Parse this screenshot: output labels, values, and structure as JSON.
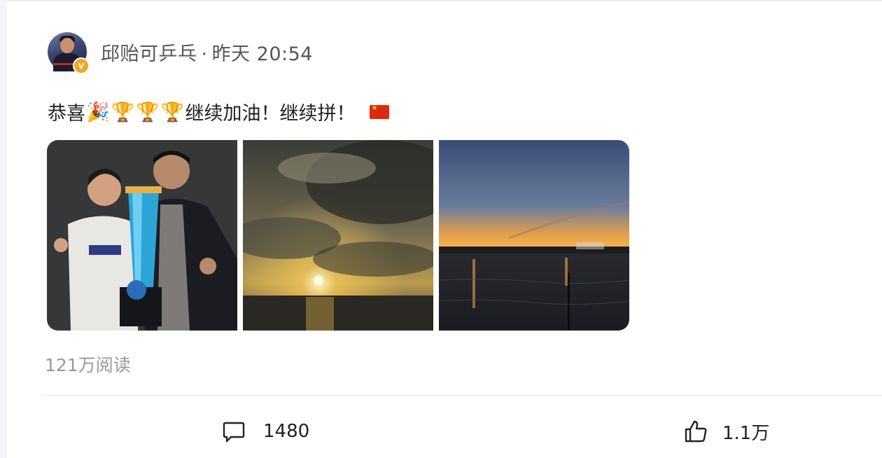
{
  "post": {
    "author": "邱贻可乒乓",
    "separator": "·",
    "time": "昨天 20:54",
    "verified_badge": "V",
    "text_before": "恭喜",
    "emojis": [
      "🎉",
      "🏆",
      "🏆",
      "🏆"
    ],
    "text_after": "继续加油！继续拼！",
    "flag_icon": "china-flag-icon",
    "images": [
      {
        "subject": "trophy-photo"
      },
      {
        "subject": "sunset-sky-photo"
      },
      {
        "subject": "harbor-sunset-photo"
      }
    ],
    "reads": "121万阅读"
  },
  "actions": {
    "comment_count": "1480",
    "like_count": "1.1万"
  },
  "colors": {
    "badge": "#f5a623",
    "text": "#222222",
    "muted": "#999999"
  }
}
